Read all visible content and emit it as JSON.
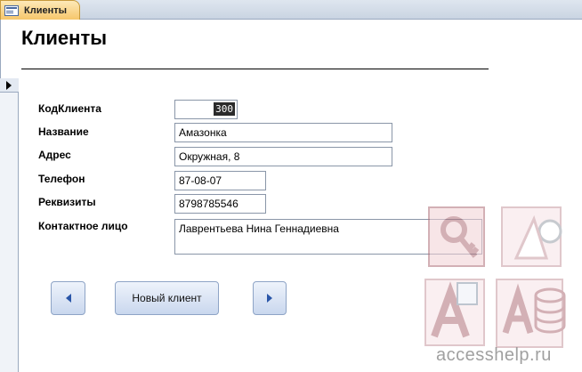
{
  "tab": {
    "label": "Клиенты",
    "icon": "form-icon"
  },
  "form": {
    "title": "Клиенты"
  },
  "record_selector": {
    "icon": "current-record-arrow-icon"
  },
  "fields": [
    {
      "label": "КодКлиента",
      "value": "300"
    },
    {
      "label": "Название",
      "value": "Амазонка"
    },
    {
      "label": "Адрес",
      "value": "Окружная, 8"
    },
    {
      "label": "Телефон",
      "value": "87-08-07"
    },
    {
      "label": "Реквизиты",
      "value": "8798785546"
    },
    {
      "label": "Контактное лицо",
      "value": "Лаврентьева Нина Геннадиевна"
    }
  ],
  "buttons": {
    "prev_icon": "left-triangle-icon",
    "new_client": "Новый клиент",
    "next_icon": "right-triangle-icon"
  },
  "watermark": {
    "text": "accesshelp.ru"
  },
  "colors": {
    "tab_active": "#f6c66b",
    "accent": "#2a56a8",
    "button_face": "#c9d7ee"
  }
}
